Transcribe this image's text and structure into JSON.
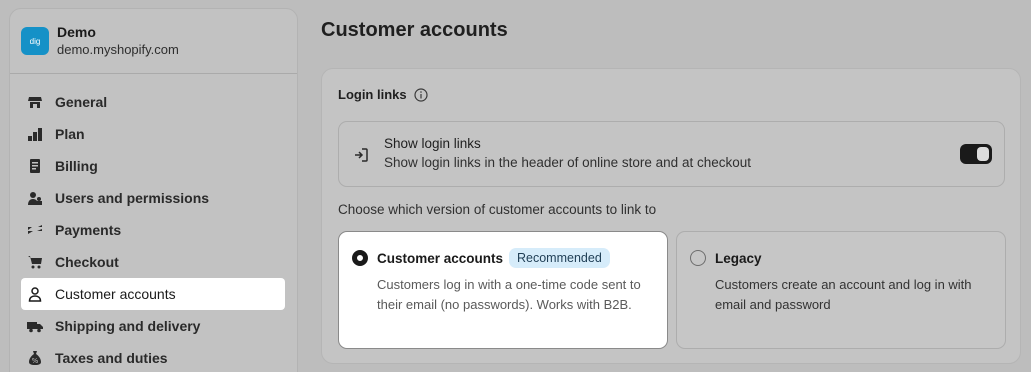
{
  "store": {
    "logo_text": "dig",
    "name": "Demo",
    "domain": "demo.myshopify.com"
  },
  "sidebar": {
    "items": [
      {
        "label": "General",
        "icon": "store-icon"
      },
      {
        "label": "Plan",
        "icon": "plan-icon"
      },
      {
        "label": "Billing",
        "icon": "billing-icon"
      },
      {
        "label": "Users and permissions",
        "icon": "users-icon"
      },
      {
        "label": "Payments",
        "icon": "payments-icon"
      },
      {
        "label": "Checkout",
        "icon": "cart-icon"
      },
      {
        "label": "Customer accounts",
        "icon": "person-icon",
        "active": true
      },
      {
        "label": "Shipping and delivery",
        "icon": "truck-icon"
      },
      {
        "label": "Taxes and duties",
        "icon": "tax-icon"
      }
    ]
  },
  "page": {
    "title": "Customer accounts"
  },
  "login_links": {
    "heading": "Login links",
    "show_title": "Show login links",
    "show_desc": "Show login links in the header of online store and at checkout",
    "toggle_on": true
  },
  "choose_label": "Choose which version of customer accounts to link to",
  "options": {
    "new": {
      "title": "Customer accounts",
      "badge": "Recommended",
      "desc": "Customers log in with a one-time code sent to their email (no passwords). Works with B2B.",
      "selected": true
    },
    "legacy": {
      "title": "Legacy",
      "desc": "Customers create an account and log in with email and password",
      "selected": false
    }
  },
  "colors": {
    "accent_blue": "#1591c7",
    "badge_bg": "#d6ecfa",
    "toggle_dark": "#1a1a1a"
  }
}
